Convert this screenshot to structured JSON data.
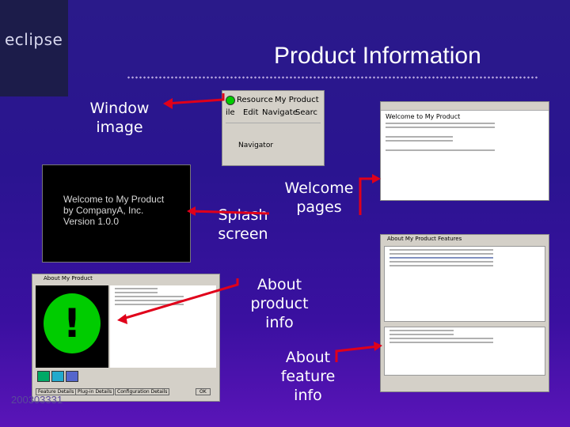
{
  "logo": {
    "text": "eclipse"
  },
  "title": "Product Information",
  "labels": {
    "window_image": "Window image",
    "splash_screen": "Splash screen",
    "welcome_pages": "Welcome pages",
    "about_product": "About product info",
    "about_feature": "About feature info"
  },
  "window_shot": {
    "tab_resource": "Resource",
    "tab_my_product": "My Product",
    "menu": [
      "ile",
      "Edit",
      "Navigate",
      "Searc"
    ],
    "navigator": "Navigator"
  },
  "splash": {
    "line1": "Welcome to My Product",
    "line2": "by CompanyA, Inc.",
    "line3": "Version 1.0.0"
  },
  "welcome_shot": {
    "heading": "Welcome to My Product"
  },
  "about_product_shot": {
    "title": "About My Product",
    "glyph": "!",
    "buttons": [
      "Feature Details",
      "Plug-in Details",
      "Configuration Details"
    ],
    "ok": "OK"
  },
  "about_feature_shot": {
    "title": "About My Product Features"
  },
  "footer": "200303331",
  "colors": {
    "arrow": "#e0001a",
    "background": "#2a1490",
    "green": "#00cc00"
  }
}
